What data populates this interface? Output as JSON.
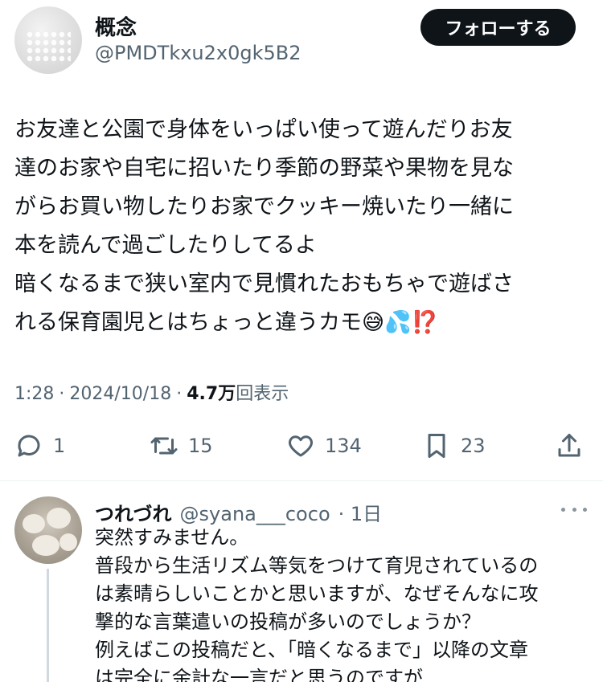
{
  "author": {
    "display_name": "概念",
    "handle": "@PMDTkxu2x0gk5B2",
    "follow_label": "フォローする"
  },
  "tweet": {
    "text": "お友達と公園で身体をいっぱい使って遊んだりお友\n達のお家や自宅に招いたり季節の野菜や果物を見な\nがらお買い物したりお家でクッキー焼いたり一緒に\n本を読んで過ごしたりしてるよ\n暗くなるまで狭い室内で見慣れたおもちゃで遊ばさ\nれる保育園児とはちょっと違うカモ😅💦⁉️",
    "time": "1:28",
    "dot1": "·",
    "date": "2024/10/18",
    "dot2": "·",
    "views": "4.7万",
    "views_label": "回表示"
  },
  "actions": {
    "replies": "1",
    "retweets": "15",
    "likes": "134",
    "bookmarks": "23"
  },
  "reply": {
    "name": "つれづれ",
    "handle": "@syana___coco",
    "time": "· 1日",
    "text": "突然すみません。\n普段から生活リズム等気をつけて育児されているの\nは素晴らしいことかと思いますが、なぜそんなに攻\n撃的な言葉遣いの投稿が多いのでしょうか？\n例えばこの投稿だと、「暗くなるまで」以降の文章\nは完全に余計な一言だと思うのですが..."
  },
  "icons": {
    "reply": "speech-bubble-icon",
    "retweet": "retweet-icon",
    "like": "heart-icon",
    "bookmark": "bookmark-icon",
    "share": "share-icon",
    "more": "more-horizontal-icon"
  },
  "colors": {
    "text": "#0f1419",
    "secondary": "#536471",
    "follow_bg": "#0f1419"
  }
}
